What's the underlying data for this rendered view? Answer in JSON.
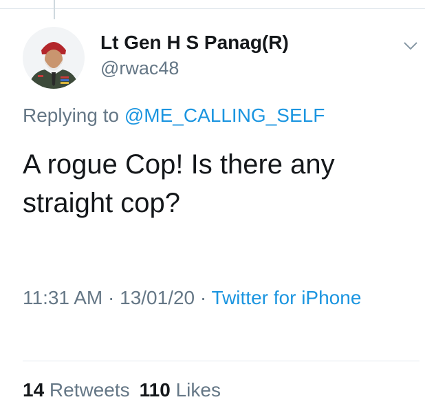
{
  "author": {
    "display_name": "Lt Gen H S Panag(R)",
    "handle": "@rwac48"
  },
  "reply": {
    "prefix": "Replying to ",
    "mention": "@ME_CALLING_SELF"
  },
  "tweet": {
    "text": "A rogue Cop! Is there any straight cop?"
  },
  "meta": {
    "time": "11:31 AM",
    "sep1": " · ",
    "date": "13/01/20",
    "sep2": " · ",
    "source": "Twitter for iPhone"
  },
  "stats": {
    "retweets_count": "14",
    "retweets_label": " Retweets",
    "likes_count": "110",
    "likes_label": " Likes"
  },
  "icons": {
    "chevron": "chevron-down-icon",
    "avatar": "avatar"
  },
  "colors": {
    "link": "#1b95e0",
    "secondary_text": "#657786",
    "primary_text": "#14171a",
    "divider": "#e1e8ed"
  }
}
